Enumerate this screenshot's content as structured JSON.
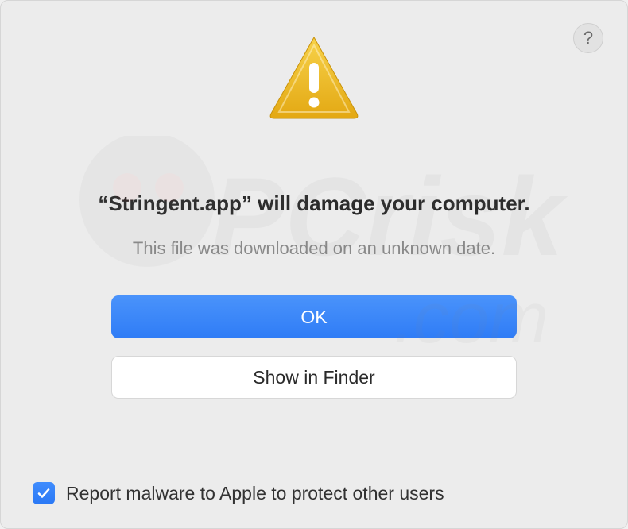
{
  "dialog": {
    "help_label": "?",
    "headline": "“Stringent.app” will damage your computer.",
    "subtext": "This file was downloaded on an unknown date.",
    "primary_button": "OK",
    "secondary_button": "Show in Finder",
    "checkbox": {
      "checked": true,
      "label": "Report malware to Apple to protect other users"
    }
  },
  "icons": {
    "warning": "warning-triangle-icon",
    "help": "help-icon",
    "checkmark": "checkmark-icon"
  },
  "colors": {
    "primary_button": "#3a85f8",
    "secondary_button": "#ffffff",
    "dialog_bg": "#ececec",
    "subtext": "#8a8a8a"
  }
}
